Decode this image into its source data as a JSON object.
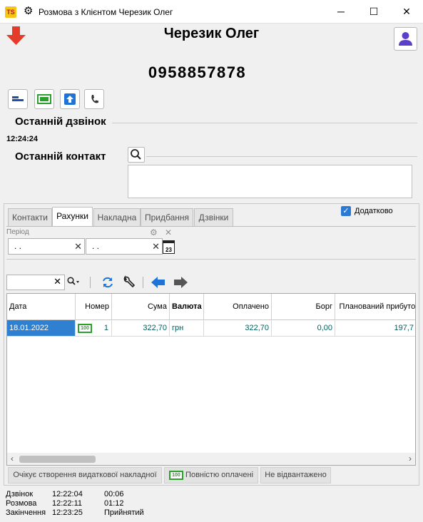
{
  "window": {
    "app_icon_text": "TS",
    "title": "Розмова з Клієнтом Черезик Олег",
    "controls": {
      "minimize": "─",
      "maximize": "☐",
      "close": "✕"
    }
  },
  "header": {
    "client_name": "Черезик Олег",
    "phone": "0958857878"
  },
  "last_call": {
    "title": "Останній дзвінок",
    "time": "12:24:24"
  },
  "last_contact": {
    "title": "Останній контакт"
  },
  "tabs": [
    {
      "label": "Контакти",
      "active": false
    },
    {
      "label": "Рахунки",
      "active": true
    },
    {
      "label": "Накладна",
      "active": false
    },
    {
      "label": "Придбання",
      "active": false
    },
    {
      "label": "Дзвінки",
      "active": false
    }
  ],
  "additional": {
    "label": "Додатково",
    "checked": true
  },
  "period": {
    "label": "Період",
    "from": " .  .",
    "to": " .  .",
    "calendar_day": "23"
  },
  "grid": {
    "columns": [
      "Дата",
      "Номер",
      "Сума",
      "Валюта",
      "Оплачено",
      "Борг",
      "Планований прибуток"
    ],
    "rows": [
      {
        "date": "18.01.2022",
        "icon": "100",
        "number": "1",
        "sum": "322,70",
        "currency": "грн",
        "paid": "322,70",
        "debt": "0,00",
        "profit": "197,7"
      }
    ]
  },
  "status_buttons": [
    {
      "label": "Очікує створення видаткової накладної"
    },
    {
      "icon": "100",
      "label": "Повністю оплачені"
    },
    {
      "label": "Не відвантажено"
    }
  ],
  "footer": {
    "rows": [
      {
        "label": "Дзвінок",
        "time": "12:22:04",
        "value": "00:06"
      },
      {
        "label": "Розмова",
        "time": "12:22:11",
        "value": "01:12"
      },
      {
        "label": "Закінчення",
        "time": "12:23:25",
        "value": "Прийнятий"
      }
    ]
  },
  "colors": {
    "accent": "#2a7ad5",
    "money_green": "#2ca02c",
    "row_selected": "#2f80d1",
    "red_arrow": "#e53c2a"
  }
}
